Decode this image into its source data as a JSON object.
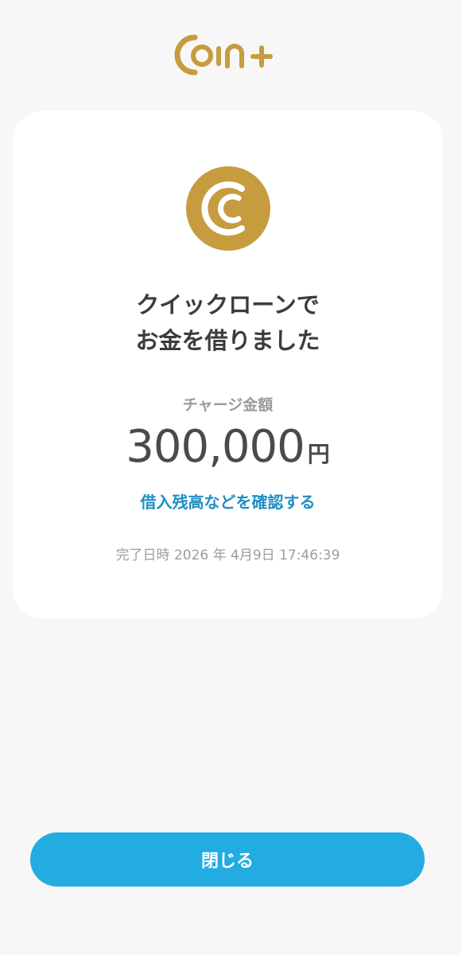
{
  "header": {
    "logo_text": "COIN+"
  },
  "result": {
    "title_line1": "クイックローンで",
    "title_line2": "お金を借りました",
    "charge_label": "チャージ金額",
    "amount": "300,000",
    "currency": "円",
    "link_label": "借入残高などを確認する",
    "completed_datetime": "完了日時 2026 年 4月9日 17:46:39"
  },
  "footer": {
    "close_label": "閉じる"
  },
  "colors": {
    "brand_gold": "#C69C3E",
    "button_blue": "#22ACE1",
    "link_blue": "#1E8FC4"
  }
}
